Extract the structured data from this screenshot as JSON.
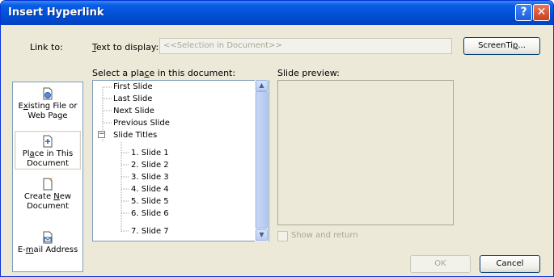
{
  "titlebar": {
    "title": "Insert Hyperlink",
    "help_glyph": "?",
    "close_glyph": "✕"
  },
  "link_to": {
    "label": "Link to:",
    "items": [
      {
        "id": "existing",
        "label_line1_pre": "E",
        "label_line1_u": "x",
        "label_line1_post": "isting File or",
        "label_line2": "Web Page",
        "icon": "file-globe-icon",
        "selected": false
      },
      {
        "id": "place",
        "label_line1_pre": "Pl",
        "label_line1_u": "a",
        "label_line1_post": "ce in This",
        "label_line2": "Document",
        "icon": "document-place-icon",
        "selected": true
      },
      {
        "id": "new",
        "label_line1_pre": "Create ",
        "label_line1_u": "N",
        "label_line1_post": "ew",
        "label_line2": "Document",
        "icon": "new-document-icon",
        "selected": false
      },
      {
        "id": "email",
        "label_line1_pre": "E-",
        "label_line1_u": "m",
        "label_line1_post": "ail Address",
        "label_line2": "",
        "icon": "email-icon",
        "selected": false
      }
    ]
  },
  "text_display": {
    "label_u": "T",
    "label_rest": "ext to display:",
    "value": "<<Selection in Document>>"
  },
  "screentip_button": {
    "label_pre": "ScreenTi",
    "label_u": "p",
    "label_post": "..."
  },
  "place_select": {
    "label_pre": "Select a pla",
    "label_u": "c",
    "label_post": "e in this document:",
    "items": [
      "First Slide",
      "Last Slide",
      "Next Slide",
      "Previous Slide",
      "Slide Titles",
      "1. Slide 1",
      "2. Slide 2",
      "3. Slide 3",
      "4. Slide 4",
      "5. Slide 5",
      "6. Slide 6",
      "7. Slide 7"
    ],
    "expander_glyph": "⊟"
  },
  "preview": {
    "label": "Slide preview:",
    "show_return_label": "Show and return"
  },
  "buttons": {
    "ok": "OK",
    "cancel": "Cancel"
  }
}
